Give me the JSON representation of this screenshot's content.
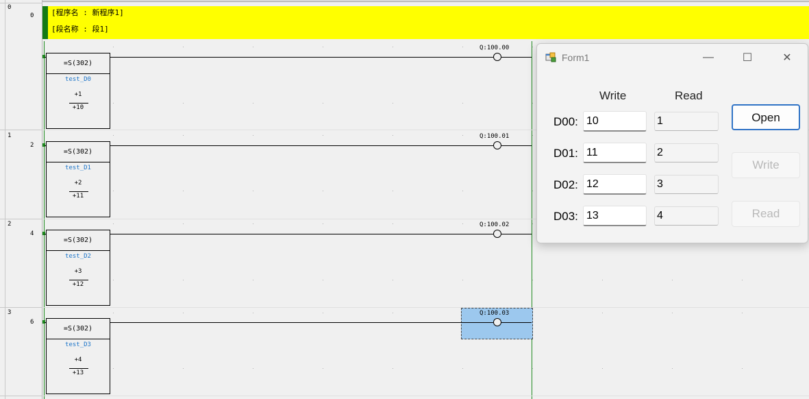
{
  "header": {
    "program_name": "[程序名 : 新程序1]",
    "section_name": "[段名称 : 段1]"
  },
  "rungs": [
    {
      "index": "0",
      "line": "0",
      "instruction": "=S(302)",
      "symbol": "test_D0",
      "operand1": "+1",
      "operand2": "+10",
      "output": "Q:100.00"
    },
    {
      "index": "1",
      "line": "2",
      "instruction": "=S(302)",
      "symbol": "test_D1",
      "operand1": "+2",
      "operand2": "+11",
      "output": "Q:100.01"
    },
    {
      "index": "2",
      "line": "4",
      "instruction": "=S(302)",
      "symbol": "test_D2",
      "operand1": "+3",
      "operand2": "+12",
      "output": "Q:100.02"
    },
    {
      "index": "3",
      "line": "6",
      "instruction": "=S(302)",
      "symbol": "test_D3",
      "operand1": "+4",
      "operand2": "+13",
      "output": "Q:100.03"
    }
  ],
  "form": {
    "title": "Form1",
    "controls": {
      "minimize": "—",
      "maximize": "☐",
      "close": "✕"
    },
    "headers": {
      "write": "Write",
      "read": "Read"
    },
    "rows": [
      {
        "label": "D00:",
        "write_value": "10",
        "read_value": "1"
      },
      {
        "label": "D01:",
        "write_value": "11",
        "read_value": "2"
      },
      {
        "label": "D02:",
        "write_value": "12",
        "read_value": "3"
      },
      {
        "label": "D03:",
        "write_value": "13",
        "read_value": "4"
      }
    ],
    "buttons": {
      "open": "Open",
      "write": "Write",
      "read": "Read"
    },
    "button_states": {
      "open": "enabled",
      "write": "disabled",
      "read": "disabled"
    }
  },
  "colors": {
    "header_bg": "#ffff00",
    "rail": "#1f8a1f",
    "symbol_text": "#1a73c8",
    "selection": "#9cc8ee",
    "accent_button": "#2f73c6"
  },
  "icons": [
    "app-form-icon",
    "minimize-icon",
    "maximize-icon",
    "close-icon"
  ]
}
